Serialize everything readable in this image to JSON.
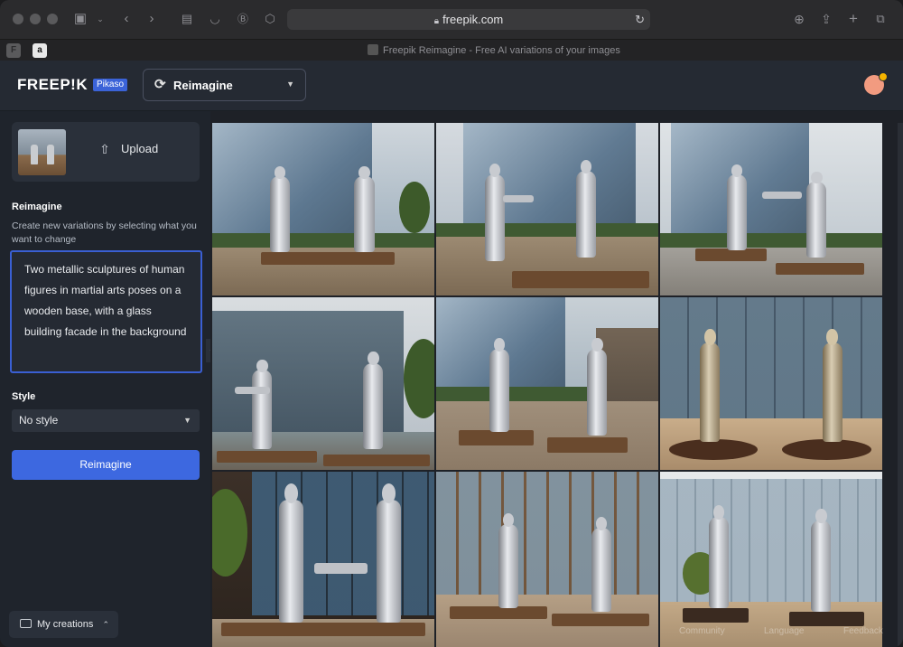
{
  "browser": {
    "url": "freepik.com",
    "tab_title": "Freepik Reimagine - Free AI variations of your images",
    "pinned_tabs": [
      "F",
      "a"
    ]
  },
  "header": {
    "logo": "FREEP!K",
    "badge": "Pikaso",
    "mode_dropdown": "Reimagine"
  },
  "sidebar": {
    "upload_label": "Upload",
    "reimagine_title": "Reimagine",
    "reimagine_description": "Create new variations by selecting what you want to change",
    "prompt": "Two metallic sculptures of human figures in martial arts poses on a wooden base, with a glass building facade in the background",
    "style_title": "Style",
    "style_value": "No style",
    "action_button": "Reimagine",
    "my_creations": "My creations"
  },
  "footer": {
    "community": "Community",
    "language": "Language",
    "feedback": "Feedback"
  },
  "colors": {
    "accent": "#3d68e0",
    "badge": "#3b63d8",
    "sidebar_bg": "#1f242c",
    "header_bg": "#252a33"
  },
  "gallery": {
    "images": [
      {
        "description_icon": "image-tile"
      },
      {
        "description_icon": "image-tile"
      },
      {
        "description_icon": "image-tile"
      },
      {
        "description_icon": "image-tile"
      },
      {
        "description_icon": "image-tile"
      },
      {
        "description_icon": "image-tile"
      },
      {
        "description_icon": "image-tile"
      },
      {
        "description_icon": "image-tile"
      },
      {
        "description_icon": "image-tile"
      }
    ]
  }
}
